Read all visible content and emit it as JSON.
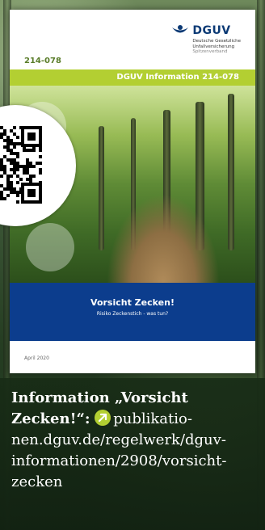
{
  "brochure": {
    "doc_number": "214-078",
    "logo": {
      "name": "DGUV",
      "sub1": "Deutsche Gesetzliche",
      "sub2": "Unfallversicherung",
      "sub3": "Spitzenverband"
    },
    "band_title": "DGUV Information 214-078",
    "title": "Vorsicht Zecken!",
    "subtitle": "Risiko Zeckenstich - was tun?",
    "date": "April 2020"
  },
  "caption": {
    "bold_text": "Information „Vorsicht Zecken!“:",
    "link_text": "publikatio-nen.dguv.de/regelwerk/dguv-informationen/2908/vorsicht-zecken"
  },
  "colors": {
    "dguv_blue": "#0c3d8d",
    "dguv_green": "#b3cf32",
    "forest_dark": "#1d311b"
  },
  "icons": {
    "link_icon": "arrow-link-icon",
    "logo_icon": "dguv-logo-icon",
    "qr_code": "qr-code"
  }
}
